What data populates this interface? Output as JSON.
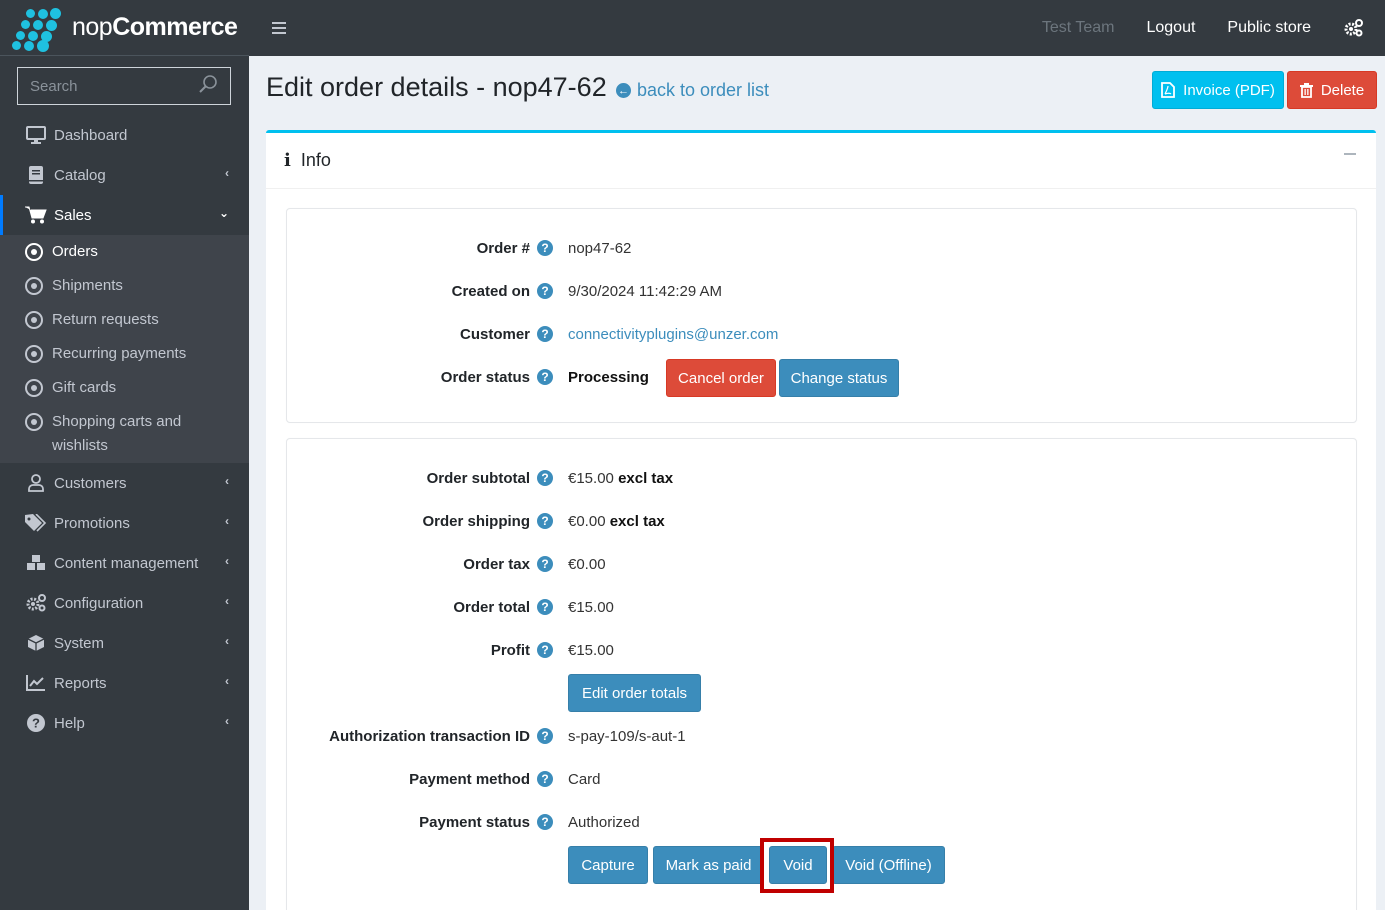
{
  "brand": {
    "name_light": "nop",
    "name_bold": "Commerce",
    "accent": "#1fc1e0"
  },
  "topbar": {
    "menu_icon": "hamburger-icon",
    "user": "Test Team",
    "logout": "Logout",
    "public_store": "Public store",
    "settings_icon": "gears-icon"
  },
  "sidebar": {
    "search_placeholder": "Search",
    "items": [
      {
        "label": "Dashboard",
        "icon": "desktop-icon",
        "has_chevron": false
      },
      {
        "label": "Catalog",
        "icon": "book-icon",
        "has_chevron": true
      },
      {
        "label": "Sales",
        "icon": "cart-icon",
        "has_chevron": true,
        "expanded": true,
        "active": true
      },
      {
        "label": "Customers",
        "icon": "user-icon",
        "has_chevron": true
      },
      {
        "label": "Promotions",
        "icon": "tags-icon",
        "has_chevron": true
      },
      {
        "label": "Content management",
        "icon": "cubes-icon",
        "has_chevron": true
      },
      {
        "label": "Configuration",
        "icon": "gears-icon",
        "has_chevron": true
      },
      {
        "label": "System",
        "icon": "cube-icon",
        "has_chevron": true
      },
      {
        "label": "Reports",
        "icon": "chart-icon",
        "has_chevron": true
      },
      {
        "label": "Help",
        "icon": "question-icon",
        "has_chevron": true
      }
    ],
    "sales_sub": [
      {
        "label": "Orders",
        "active": true
      },
      {
        "label": "Shipments"
      },
      {
        "label": "Return requests"
      },
      {
        "label": "Recurring payments"
      },
      {
        "label": "Gift cards"
      },
      {
        "label": "Shopping carts and wishlists",
        "line1": "Shopping carts and",
        "line2": "wishlists"
      }
    ]
  },
  "header": {
    "title": "Edit order details - nop47-62",
    "back_link": "back to order list",
    "invoice_button": "Invoice (PDF)",
    "delete_button": "Delete"
  },
  "card": {
    "title": "Info",
    "order_info": {
      "order_number_label": "Order #",
      "order_number": "nop47-62",
      "created_on_label": "Created on",
      "created_on": "9/30/2024 11:42:29 AM",
      "customer_label": "Customer",
      "customer": "connectivityplugins@unzer.com",
      "order_status_label": "Order status",
      "order_status": "Processing",
      "cancel_order_button": "Cancel order",
      "change_status_button": "Change status"
    },
    "totals": {
      "subtotal_label": "Order subtotal",
      "subtotal": "€15.00",
      "subtotal_suffix": "excl tax",
      "shipping_label": "Order shipping",
      "shipping": "€0.00",
      "shipping_suffix": "excl tax",
      "tax_label": "Order tax",
      "tax": "€0.00",
      "total_label": "Order total",
      "total": "€15.00",
      "profit_label": "Profit",
      "profit": "€15.00",
      "edit_totals_button": "Edit order totals",
      "auth_txn_label": "Authorization transaction ID",
      "auth_txn": "s-pay-109/s-aut-1",
      "payment_method_label": "Payment method",
      "payment_method": "Card",
      "payment_status_label": "Payment status",
      "payment_status": "Authorized",
      "capture_button": "Capture",
      "mark_paid_button": "Mark as paid",
      "void_button": "Void",
      "void_offline_button": "Void (Offline)"
    }
  },
  "help_glyph": "?",
  "colors": {
    "primary": "#3c8dbc",
    "danger": "#dd4b39",
    "info": "#00c0ef",
    "highlight": "#c00000"
  }
}
